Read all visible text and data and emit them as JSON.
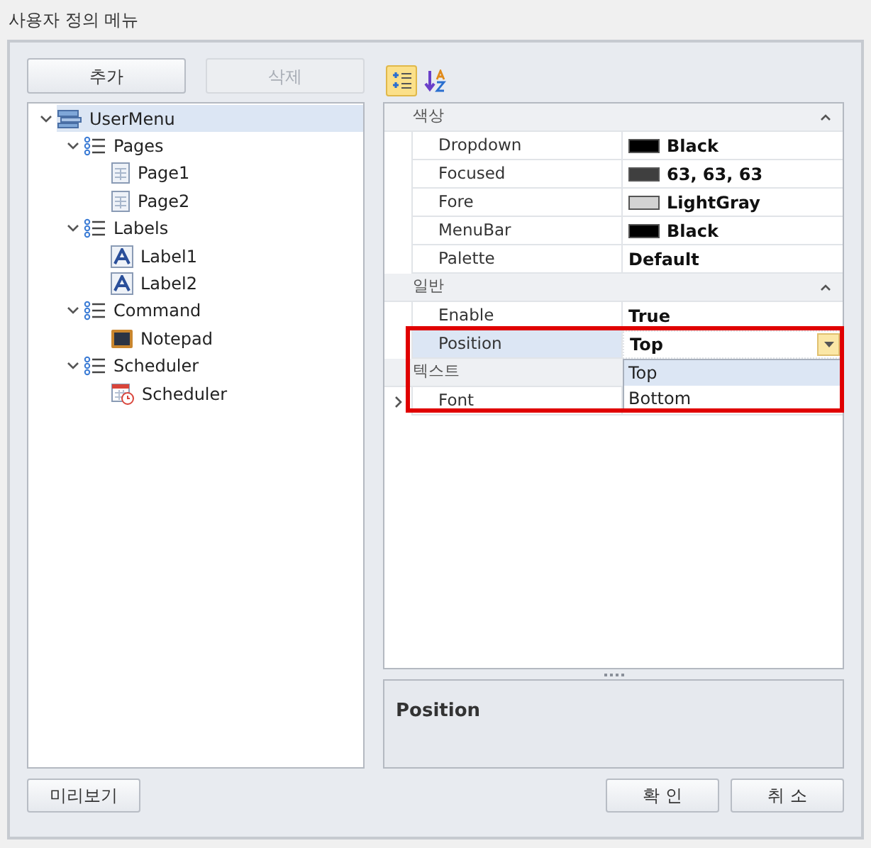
{
  "window": {
    "title": "사용자 정의 메뉴"
  },
  "toolbar": {
    "buttons": [
      {
        "label": "추가",
        "disabled": false
      },
      {
        "label": "삭제",
        "disabled": true
      }
    ],
    "sort_buttons": [
      {
        "kind": "categorized",
        "selected": true
      },
      {
        "kind": "alphabetical",
        "selected": false
      }
    ]
  },
  "tree": [
    {
      "label": "UserMenu",
      "kind": "menu",
      "expanded": true,
      "selected": true,
      "children": [
        {
          "label": "Pages",
          "kind": "group",
          "expanded": true,
          "selected": false,
          "children": [
            {
              "label": "Page1",
              "kind": "page",
              "selected": false
            },
            {
              "label": "Page2",
              "kind": "page",
              "selected": false
            }
          ]
        },
        {
          "label": "Labels",
          "kind": "group",
          "expanded": true,
          "selected": false,
          "children": [
            {
              "label": "Label1",
              "kind": "label",
              "selected": false
            },
            {
              "label": "Label2",
              "kind": "label",
              "selected": false
            }
          ]
        },
        {
          "label": "Command",
          "kind": "group",
          "expanded": true,
          "selected": false,
          "children": [
            {
              "label": "Notepad",
              "kind": "command",
              "selected": false
            }
          ]
        },
        {
          "label": "Scheduler",
          "kind": "group",
          "expanded": true,
          "selected": false,
          "children": [
            {
              "label": "Scheduler",
              "kind": "scheduler",
              "selected": false
            }
          ]
        }
      ]
    }
  ],
  "properties": {
    "categories": [
      {
        "name": "색상",
        "expanded": true,
        "rows": [
          {
            "name": "Dropdown",
            "value": "Black",
            "color": "#000000",
            "selected": false
          },
          {
            "name": "Focused",
            "value": "63, 63, 63",
            "color": "#3f3f3f",
            "selected": false
          },
          {
            "name": "Fore",
            "value": "LightGray",
            "color": "#d3d3d3",
            "selected": false
          },
          {
            "name": "MenuBar",
            "value": "Black",
            "color": "#000000",
            "selected": false
          },
          {
            "name": "Palette",
            "value": "Default",
            "selected": false
          }
        ]
      },
      {
        "name": "일반",
        "expanded": true,
        "rows": [
          {
            "name": "Enable",
            "value": "True",
            "selected": false
          },
          {
            "name": "Position",
            "value": "Top",
            "selected": true,
            "dropdown": {
              "options": [
                {
                  "label": "Top",
                  "selected": true
                },
                {
                  "label": "Bottom",
                  "selected": false
                }
              ]
            }
          }
        ]
      },
      {
        "name": "텍스트",
        "rows": [
          {
            "name": "Font",
            "expanded": false,
            "selected": false
          }
        ]
      }
    ]
  },
  "description": {
    "title": "Position"
  },
  "footer": {
    "preview_button": "미리보기",
    "ok_button": "확 인",
    "cancel_button": "취 소"
  }
}
